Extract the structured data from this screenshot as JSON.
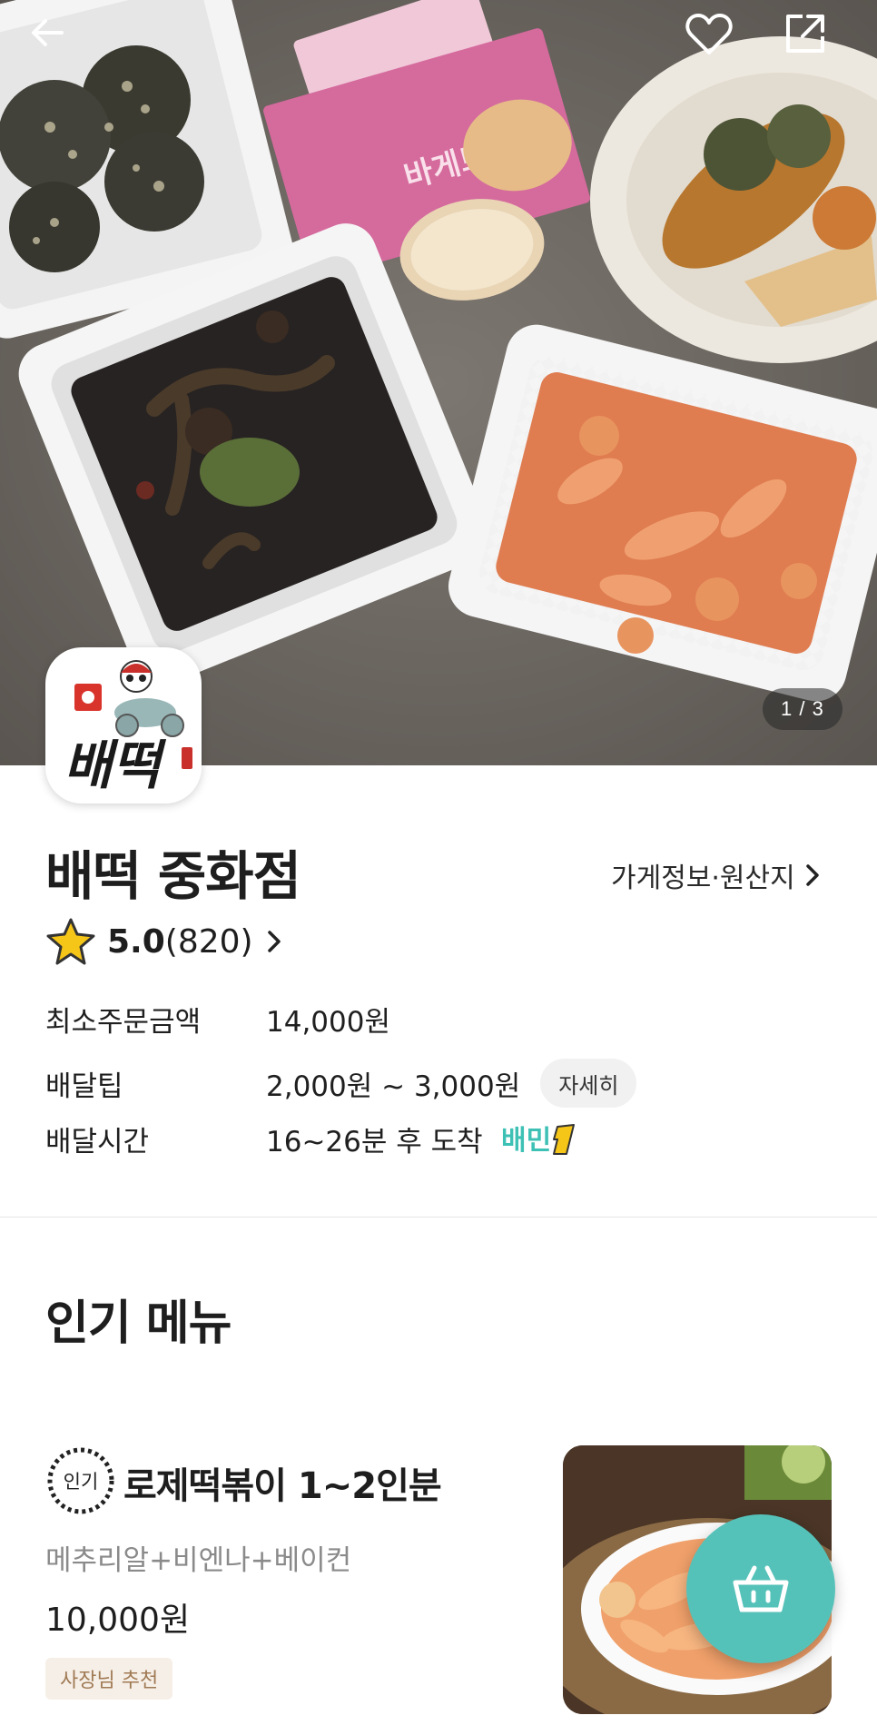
{
  "hero": {
    "counter": "1 / 3",
    "package_text": "바게트러스크"
  },
  "store": {
    "name": "배떡 중화점",
    "logo_text": "배떡",
    "info_link": "가게정보·원산지",
    "rating": "5.0",
    "review_count": "(820)"
  },
  "info": {
    "min_order_label": "최소주문금액",
    "min_order_value": "14,000원",
    "tip_label": "배달팁",
    "tip_value": "2,000원 ~ 3,000원",
    "detail_button": "자세히",
    "time_label": "배달시간",
    "time_value": "16~26분 후 도착",
    "baemin_badge": "배민"
  },
  "popular": {
    "title": "인기 메뉴",
    "badge": "인기",
    "item": {
      "name": "로제떡볶이 1~2인분",
      "desc": "메추리알+비엔나+베이컨",
      "price": "10,000원",
      "tag": "사장님 추천"
    }
  },
  "icons": {
    "back": "back-arrow-icon",
    "like": "heart-icon",
    "share": "share-icon",
    "star": "star-icon",
    "chevron": "chevron-right-icon",
    "cart": "shopping-basket-icon"
  },
  "colors": {
    "accent": "#55c2b9",
    "star": "#f5c518",
    "tag_bg": "#f6efe7",
    "tag_text": "#a07a55"
  }
}
